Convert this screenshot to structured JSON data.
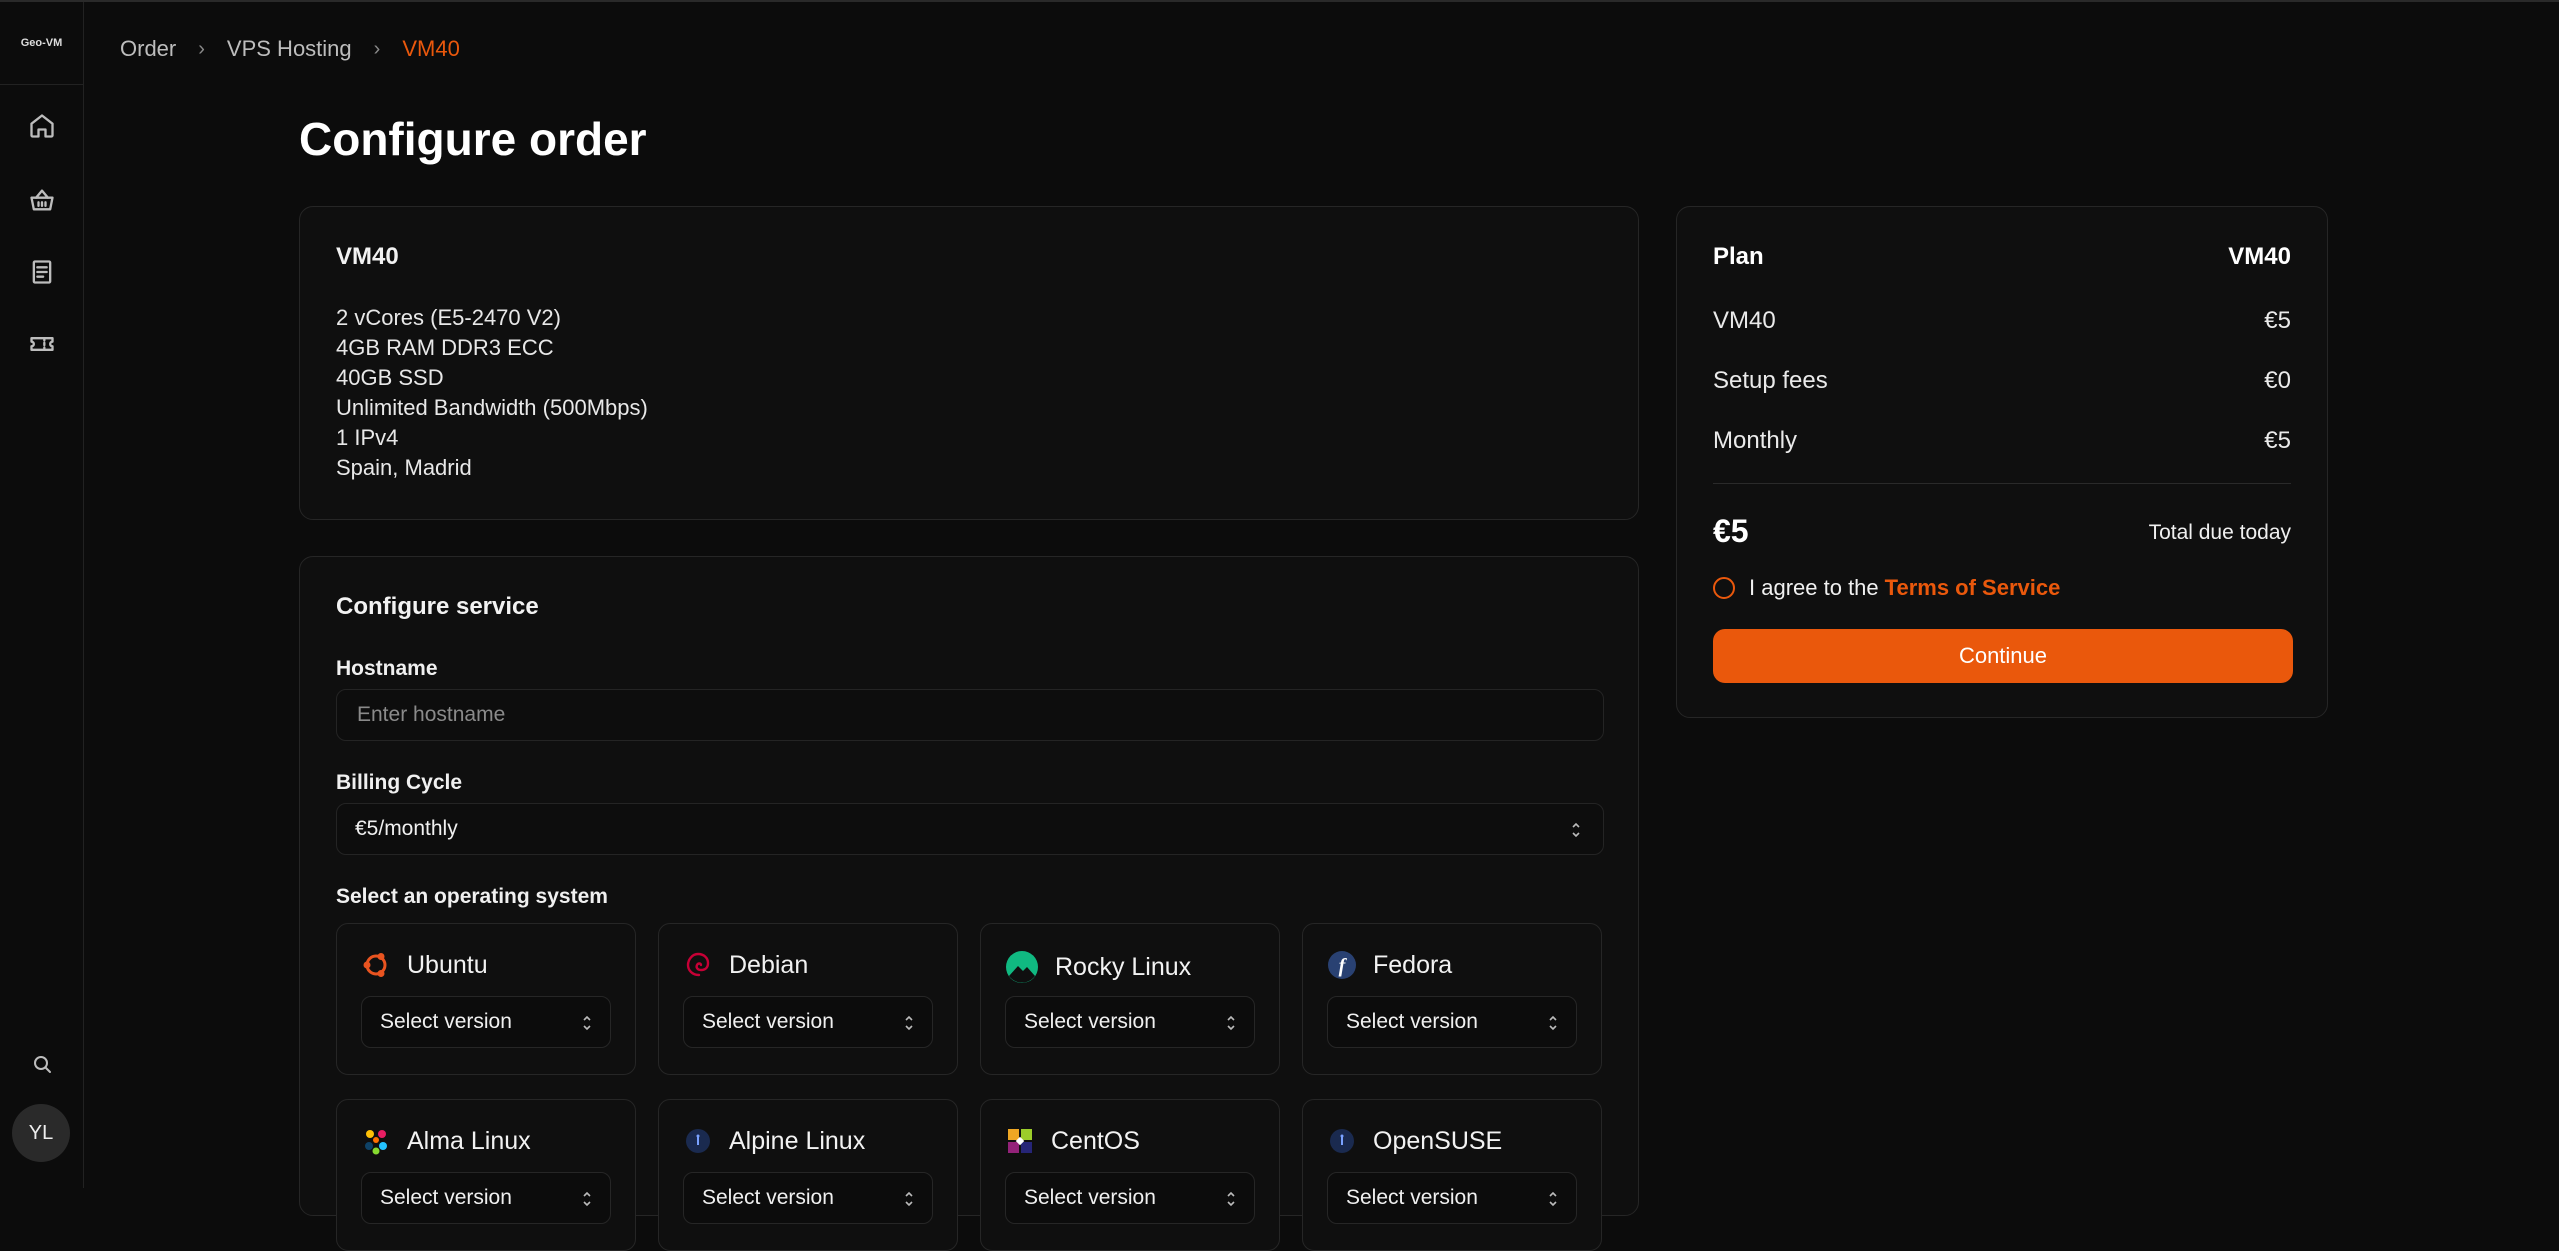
{
  "sidebar": {
    "logo_text": "Geo-VM",
    "nav_icons": [
      "home-icon",
      "basket-icon",
      "invoice-icon",
      "ticket-icon"
    ],
    "bottom_icons": [
      "search-icon"
    ],
    "avatar_initials": "YL"
  },
  "breadcrumb": {
    "items": [
      "Order",
      "VPS Hosting",
      "VM40"
    ],
    "accent_color": "#ea580c"
  },
  "page_title": "Configure order",
  "plan_card": {
    "title": "VM40",
    "specs": [
      "2 vCores (E5-2470 V2)",
      "4GB RAM DDR3 ECC",
      "40GB SSD",
      "Unlimited Bandwidth (500Mbps)",
      "1 IPv4",
      "Spain, Madrid"
    ]
  },
  "configure": {
    "title": "Configure service",
    "hostname_label": "Hostname",
    "hostname_placeholder": "Enter hostname",
    "hostname_value": "",
    "billing_label": "Billing Cycle",
    "billing_value": "€5/monthly",
    "os_label": "Select an operating system",
    "os_options": [
      {
        "name": "Ubuntu",
        "icon": "ubuntu-icon",
        "version_placeholder": "Select version"
      },
      {
        "name": "Debian",
        "icon": "debian-icon",
        "version_placeholder": "Select version"
      },
      {
        "name": "Rocky Linux",
        "icon": "rocky-linux-icon",
        "version_placeholder": "Select version"
      },
      {
        "name": "Fedora",
        "icon": "fedora-icon",
        "version_placeholder": "Select version"
      },
      {
        "name": "Alma Linux",
        "icon": "alma-linux-icon",
        "version_placeholder": "Select version"
      },
      {
        "name": "Alpine Linux",
        "icon": "alpine-linux-icon",
        "version_placeholder": "Select version"
      },
      {
        "name": "CentOS",
        "icon": "centos-icon",
        "version_placeholder": "Select version"
      },
      {
        "name": "OpenSUSE",
        "icon": "opensuse-icon",
        "version_placeholder": "Select version"
      }
    ]
  },
  "summary": {
    "plan_label": "Plan",
    "plan_value": "VM40",
    "rows": [
      {
        "label": "VM40",
        "value": "€5"
      },
      {
        "label": "Setup fees",
        "value": "€0"
      },
      {
        "label": "Monthly",
        "value": "€5"
      }
    ],
    "total": "€5",
    "total_label": "Total due today",
    "agree_text": "I agree to the",
    "tos_text": "Terms of Service",
    "continue_label": "Continue"
  }
}
